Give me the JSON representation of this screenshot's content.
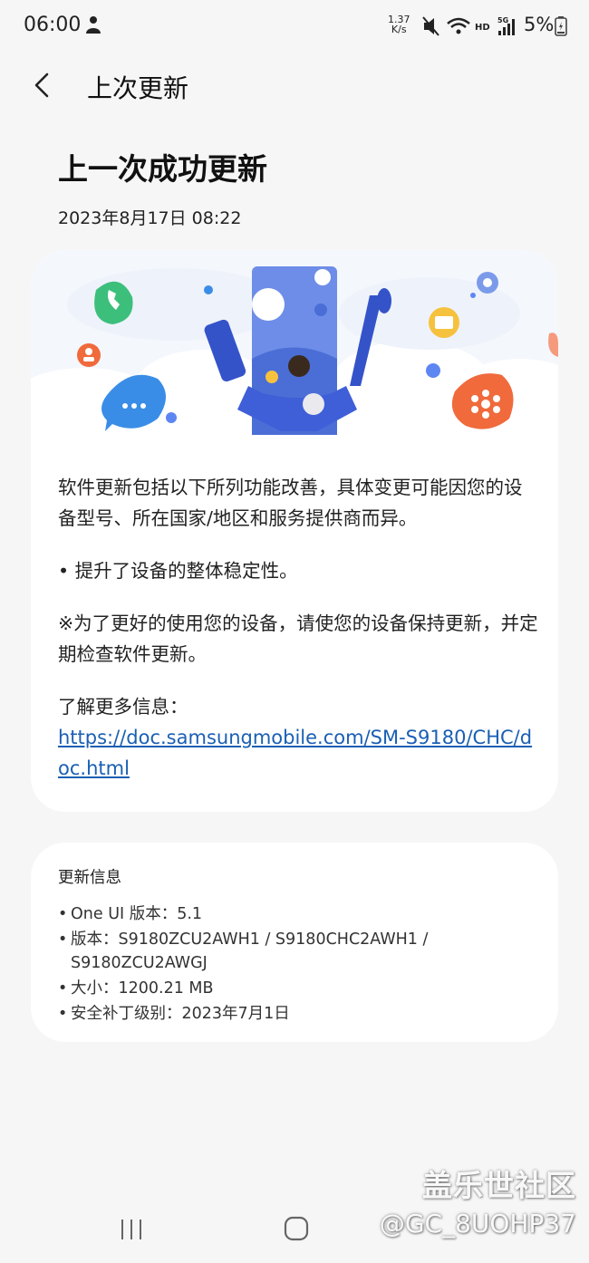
{
  "status_bar": {
    "time": "06:00",
    "net_speed_value": "1.37",
    "net_speed_unit": "K/s",
    "hd_label": "HD",
    "signal_label": "5G",
    "battery_percent": "5%",
    "icons": [
      "person-icon",
      "mute-icon",
      "wifi-icon",
      "signal-icon",
      "battery-icon"
    ]
  },
  "header": {
    "title": "上次更新"
  },
  "update": {
    "heading": "上一次成功更新",
    "date": "2023年8月17日 08:22"
  },
  "release_notes": {
    "intro": "软件更新包括以下所列功能改善，具体变更可能因您的设备型号、所在国家/地区和服务提供商而异。",
    "item": "• 提升了设备的整体稳定性。",
    "note": "※为了更好的使用您的设备，请使您的设备保持更新，并定期检查软件更新。",
    "more_label": "了解更多信息：",
    "link": "https://doc.samsungmobile.com/SM-S9180/CHC/doc.html"
  },
  "update_info": {
    "title": "更新信息",
    "items": [
      {
        "label": "One UI 版本：",
        "value": "5.1"
      },
      {
        "label": "版本：",
        "value": "S9180ZCU2AWH1 / S9180CHC2AWH1 / S9180ZCU2AWGJ"
      },
      {
        "label": "大小：",
        "value": "1200.21 MB"
      },
      {
        "label": "安全补丁级别：",
        "value": "2023年7月1日"
      }
    ]
  },
  "watermark": {
    "site": "盖乐世社区",
    "user": "@GC_8UOHP37"
  },
  "colors": {
    "background": "#f6f6f6",
    "card": "#ffffff",
    "link": "#1a5fb4",
    "hero_blue": "#4a6fe0",
    "hero_orange": "#f06a3c",
    "hero_green": "#3dbf7c",
    "hero_yellow": "#f6c23e"
  }
}
